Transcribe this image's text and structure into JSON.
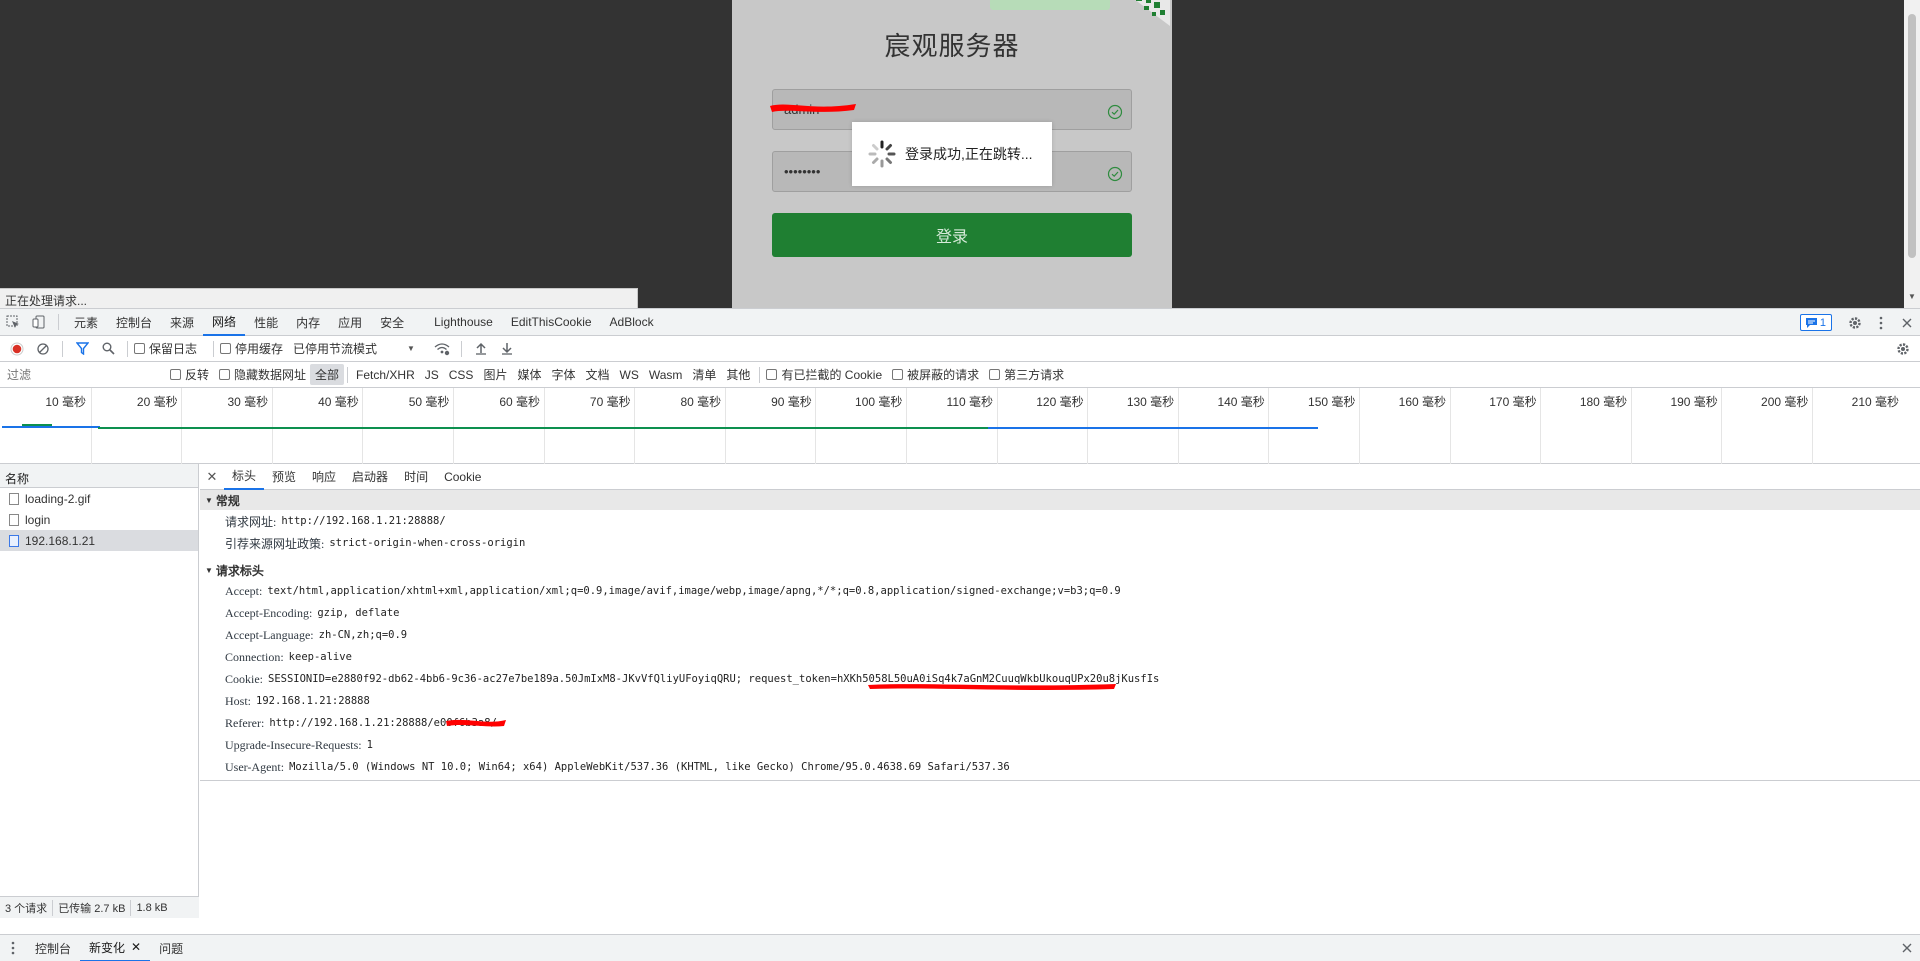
{
  "login_page": {
    "title": "宸观服务器",
    "username_value": "admin",
    "password_value": "••••••••",
    "login_button": "登录",
    "toast_text": "登录成功,正在跳转...",
    "status_tip": "正在处理请求..."
  },
  "devtools": {
    "tabs": [
      "元素",
      "控制台",
      "来源",
      "网络",
      "性能",
      "内存",
      "应用",
      "安全",
      "Lighthouse",
      "EditThisCookie",
      "AdBlock"
    ],
    "active_tab": "网络",
    "issues_count": "1",
    "toolbar": {
      "preserve_log": "保留日志",
      "disable_cache": "停用缓存",
      "throttling": "已停用节流模式"
    },
    "filter": {
      "placeholder": "过滤",
      "invert": "反转",
      "hide_data_urls": "隐藏数据网址",
      "types": [
        "全部",
        "Fetch/XHR",
        "JS",
        "CSS",
        "图片",
        "媒体",
        "字体",
        "文档",
        "WS",
        "Wasm",
        "清单",
        "其他"
      ],
      "active_type": "全部",
      "blocked_cookies": "有已拦截的 Cookie",
      "blocked_requests": "被屏蔽的请求",
      "third_party": "第三方请求"
    },
    "overview_ticks": [
      "10 毫秒",
      "20 毫秒",
      "30 毫秒",
      "40 毫秒",
      "50 毫秒",
      "60 毫秒",
      "70 毫秒",
      "80 毫秒",
      "90 毫秒",
      "100 毫秒",
      "110 毫秒",
      "120 毫秒",
      "130 毫秒",
      "140 毫秒",
      "150 毫秒",
      "160 毫秒",
      "170 毫秒",
      "180 毫秒",
      "190 毫秒",
      "200 毫秒",
      "210 毫秒"
    ],
    "requests": {
      "header": "名称",
      "items": [
        {
          "name": "loading-2.gif",
          "type": "image"
        },
        {
          "name": "login",
          "type": "xhr"
        },
        {
          "name": "192.168.1.21",
          "type": "document"
        }
      ],
      "selected": "192.168.1.21",
      "footer": {
        "count": "3 个请求",
        "transferred": "已传输 2.7 kB",
        "resources": "1.8 kB"
      }
    },
    "detail": {
      "tabs": [
        "标头",
        "预览",
        "响应",
        "启动器",
        "时间",
        "Cookie"
      ],
      "active_tab": "标头",
      "general_title": "常规",
      "general": [
        {
          "key": "请求网址:",
          "value": "http://192.168.1.21:28888/"
        },
        {
          "key": "引荐来源网址政策:",
          "value": "strict-origin-when-cross-origin"
        }
      ],
      "request_headers_title": "请求标头",
      "request_headers": [
        {
          "key": "Accept:",
          "value": "text/html,application/xhtml+xml,application/xml;q=0.9,image/avif,image/webp,image/apng,*/*;q=0.8,application/signed-exchange;v=b3;q=0.9"
        },
        {
          "key": "Accept-Encoding:",
          "value": "gzip, deflate"
        },
        {
          "key": "Accept-Language:",
          "value": "zh-CN,zh;q=0.9"
        },
        {
          "key": "Connection:",
          "value": "keep-alive"
        },
        {
          "key": "Cookie:",
          "value": "SESSIONID=e2880f92-db62-4bb6-9c36-ac27e7be189a.50JmIxM8-JKvVfQliyUFoyiqQRU; request_token=hXKh5058L50uA0iSq4k7aGnM2CuuqWkbUkouqUPx20u8jKusfIs"
        },
        {
          "key": "Host:",
          "value": "192.168.1.21:28888"
        },
        {
          "key": "Referer:",
          "value": "http://192.168.1.21:28888/e00f6b3a8/"
        },
        {
          "key": "Upgrade-Insecure-Requests:",
          "value": "1"
        },
        {
          "key": "User-Agent:",
          "value": "Mozilla/5.0 (Windows NT 10.0; Win64; x64) AppleWebKit/537.36 (KHTML, like Gecko) Chrome/95.0.4638.69 Safari/537.36"
        }
      ]
    },
    "drawer": {
      "tabs": [
        "控制台",
        "新变化",
        "问题"
      ],
      "active_tab": "新变化"
    }
  },
  "colors": {
    "page_bg": "#333333",
    "login_green": "#1f7f32",
    "accent_blue": "#1a73e8",
    "record_red": "#d93025",
    "redaction_red": "#ff0000"
  }
}
